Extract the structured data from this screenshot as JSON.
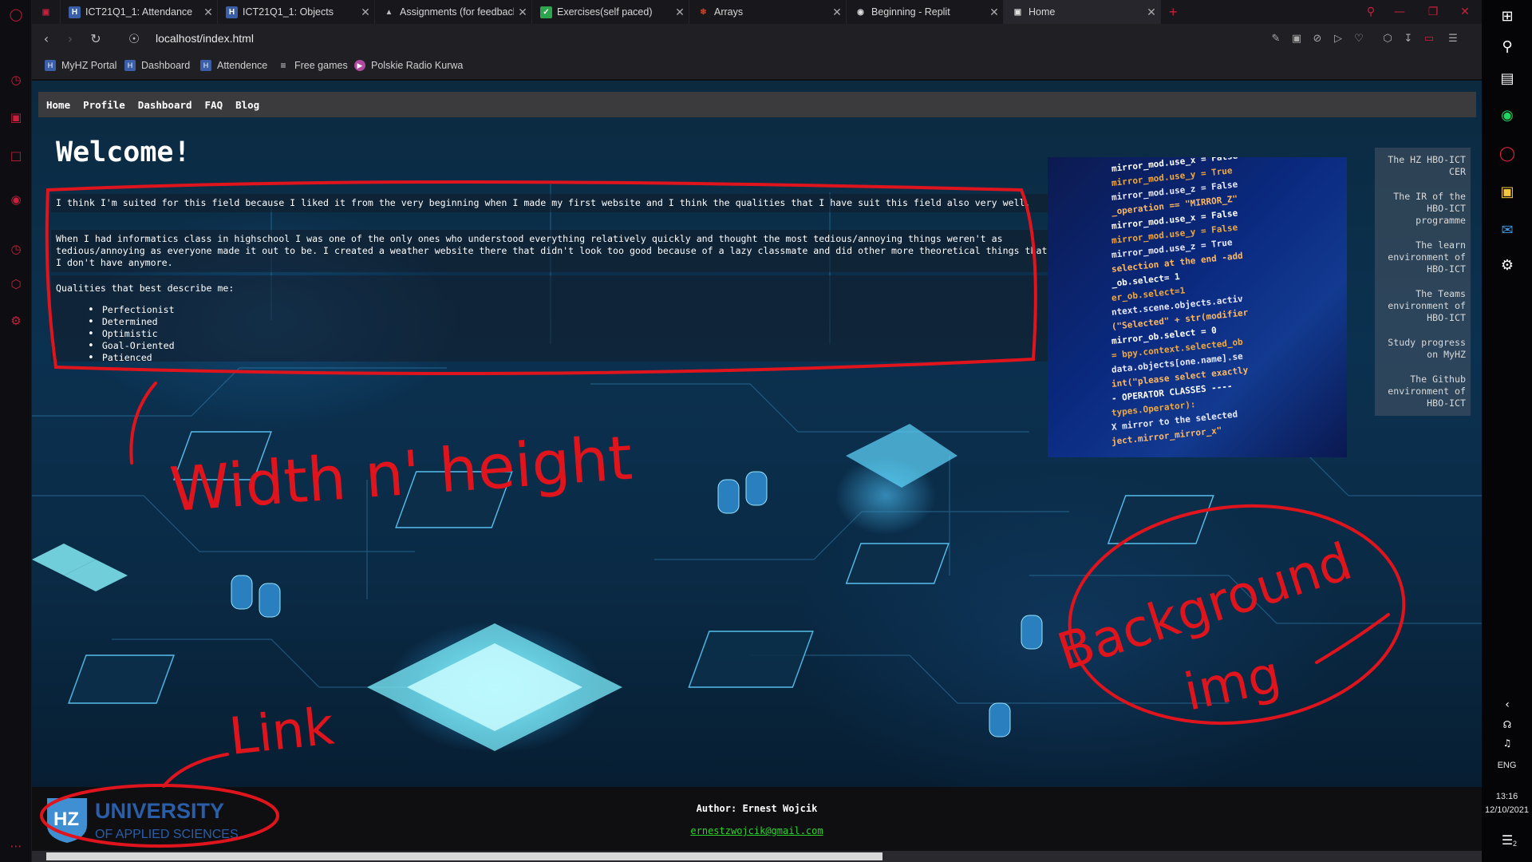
{
  "browser": {
    "tabs": [
      {
        "title": "ICT21Q1_1: Attendance",
        "favicon": "hz-icon"
      },
      {
        "title": "ICT21Q1_1: Objects",
        "favicon": "hz-icon"
      },
      {
        "title": "Assignments (for feedback)",
        "favicon": "graduation-cap-icon"
      },
      {
        "title": "Exercises(self paced)",
        "favicon": "checkmark-icon"
      },
      {
        "title": "Arrays",
        "favicon": "figure-icon"
      },
      {
        "title": "Beginning - Replit",
        "favicon": "replit-icon"
      },
      {
        "title": "Home",
        "favicon": "gamepad-icon",
        "active": true
      }
    ],
    "url": "localhost/index.html",
    "bookmarks": [
      {
        "label": "MyHZ Portal"
      },
      {
        "label": "Dashboard"
      },
      {
        "label": "Attendence"
      },
      {
        "label": "Free games"
      },
      {
        "label": "Polskie Radio Kurwa"
      }
    ]
  },
  "site": {
    "nav": [
      "Home",
      "Profile",
      "Dashboard",
      "FAQ",
      "Blog"
    ],
    "heading": "Welcome!",
    "paragraph_1": "I think I'm suited for this field because I liked it from the very beginning when I made my first website and I think the qualities that I have suit this field also very well.",
    "paragraph_2": "When I had informatics class in highschool I was one of the only ones who understood everything relatively quickly and thought the most tedious/annoying things weren't as tedious/annoying as everyone made it out to be. I created a weather website there that didn't look too good because of a lazy classmate and did other more theoretical things that I don't have anymore.",
    "qualities_title": "Qualities that best describe me:",
    "qualities": [
      "Perfectionist",
      "Determined",
      "Optimistic",
      "Goal-Oriented",
      "Patienced"
    ],
    "code_image_lines": [
      "mirror_mod.use_x = False",
      "mirror_mod.use_y = True",
      "mirror_mod.use_z = False",
      "_operation == \"MIRROR_Z\"",
      "mirror_mod.use_x = False",
      "mirror_mod.use_y = False",
      "mirror_mod.use_z = True",
      "selection at the end -add",
      "_ob.select= 1",
      "er_ob.select=1",
      "ntext.scene.objects.activ",
      "(\"Selected\" + str(modifier",
      "mirror_ob.select = 0",
      "= bpy.context.selected_ob",
      "data.objects[one.name].se",
      "int(\"please select exactly",
      "- OPERATOR CLASSES ----",
      "types.Operator):",
      "X mirror to the selected",
      "ject.mirror_mirror_x\""
    ],
    "aside_links": [
      "The HZ HBO-ICT CER",
      "The IR of the HBO-ICT programme",
      "The learn environment of HBO-ICT",
      "The Teams environment of HBO-ICT",
      "Study progress on MyHZ",
      "The Github environment of HBO-ICT"
    ],
    "footer": {
      "logo_text_1": "UNIVERSITY",
      "logo_text_2": "OF APPLIED SCIENCES",
      "logo_mark": "HZ",
      "author": "Author: Ernest Wojcik",
      "email": "ernestzwojcik@gmail.com"
    }
  },
  "annotations": {
    "label_1": "Width n' height",
    "label_2": "Background",
    "label_3": "img",
    "label_4": "Link",
    "color": "#e0141c"
  },
  "taskbar": {
    "language": "ENG",
    "time": "13:16",
    "date": "12/10/2021",
    "notification_count": "2"
  },
  "colors": {
    "accent": "#c8203c",
    "link": "#2bd42b",
    "nav_bg": "#3b3b3d"
  }
}
